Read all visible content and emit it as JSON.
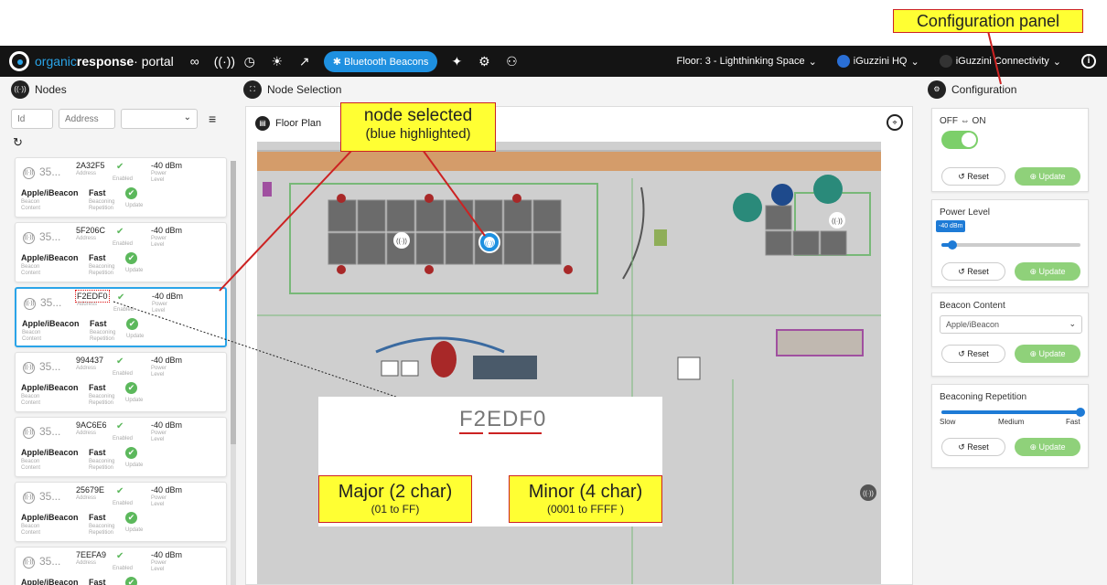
{
  "navbar": {
    "brand_part1": "organic",
    "brand_part2": "response",
    "brand_part3": "· portal",
    "nav_icons": [
      "glasses-icon",
      "broadcast-icon",
      "clock-icon",
      "lightbulb-icon",
      "rocket-icon"
    ],
    "active_tab": "Bluetooth Beacons",
    "extra_icons": [
      "puzzle-icon",
      "gear-icon",
      "users-icon"
    ],
    "floor_dropdown": "Floor: 3 - Lighthinking Space",
    "hq_dropdown": "iGuzzini HQ",
    "connectivity_dropdown": "iGuzzini Connectivity"
  },
  "nodes_panel": {
    "title": "Nodes",
    "id_placeholder": "Id",
    "address_placeholder": "Address",
    "items": [
      {
        "num": "35...",
        "address": "2A32F5",
        "address_label": "Address",
        "enabled_label": "Enabled",
        "power": "-40 dBm",
        "power_label": "Power Level",
        "content": "Apple/iBeacon",
        "content_label": "Beacon Content",
        "repetition": "Fast",
        "repetition_label": "Beaconing Repetition",
        "update_label": "Update"
      },
      {
        "num": "35...",
        "address": "5F206C",
        "address_label": "Address",
        "enabled_label": "Enabled",
        "power": "-40 dBm",
        "power_label": "Power Level",
        "content": "Apple/iBeacon",
        "content_label": "Beacon Content",
        "repetition": "Fast",
        "repetition_label": "Beaconing Repetition",
        "update_label": "Update"
      },
      {
        "num": "35...",
        "address": "F2EDF0",
        "address_label": "Address",
        "enabled_label": "Enabled",
        "power": "-40 dBm",
        "power_label": "Power Level",
        "content": "Apple/iBeacon",
        "content_label": "Beacon Content",
        "repetition": "Fast",
        "repetition_label": "Beaconing Repetition",
        "update_label": "Update"
      },
      {
        "num": "35...",
        "address": "994437",
        "address_label": "Address",
        "enabled_label": "Enabled",
        "power": "-40 dBm",
        "power_label": "Power Level",
        "content": "Apple/iBeacon",
        "content_label": "Beacon Content",
        "repetition": "Fast",
        "repetition_label": "Beaconing Repetition",
        "update_label": "Update"
      },
      {
        "num": "35...",
        "address": "9AC6E6",
        "address_label": "Address",
        "enabled_label": "Enabled",
        "power": "-40 dBm",
        "power_label": "Power Level",
        "content": "Apple/iBeacon",
        "content_label": "Beacon Content",
        "repetition": "Fast",
        "repetition_label": "Beaconing Repetition",
        "update_label": "Update"
      },
      {
        "num": "35...",
        "address": "25679E",
        "address_label": "Address",
        "enabled_label": "Enabled",
        "power": "-40 dBm",
        "power_label": "Power Level",
        "content": "Apple/iBeacon",
        "content_label": "Beacon Content",
        "repetition": "Fast",
        "repetition_label": "Beaconing Repetition",
        "update_label": "Update"
      },
      {
        "num": "35...",
        "address": "7EEFA9",
        "address_label": "Address",
        "enabled_label": "Enabled",
        "power": "-40 dBm",
        "power_label": "Power Level",
        "content": "Apple/iBeacon",
        "content_label": "Beacon Content",
        "repetition": "Fast",
        "repetition_label": "Beaconing Repetition",
        "update_label": "Update"
      }
    ],
    "selected_index": 2
  },
  "center_panel": {
    "title": "Node Selection",
    "floor_plan_title": "Floor Plan"
  },
  "config_panel": {
    "title": "Configuration",
    "onoff": {
      "title": "OFF ⇔ ON",
      "on": true
    },
    "power": {
      "title": "Power Level",
      "value": "-40 dBm",
      "level_fraction": 0.08
    },
    "content": {
      "title": "Beacon Content",
      "selected": "Apple/iBeacon"
    },
    "repetition": {
      "title": "Beaconing Repetition",
      "labels": [
        "Slow",
        "Medium",
        "Fast"
      ],
      "level_fraction": 1.0
    },
    "reset_label": "Reset",
    "update_label": "Update"
  },
  "annotations": {
    "config_panel": "Configuration panel",
    "node_selected_line1": "node selected",
    "node_selected_line2": "(blue highlighted)",
    "big_address_major": "F2",
    "big_address_minor": "EDF0",
    "major_line1": "Major (2 char)",
    "major_line2": "(01 to FF)",
    "minor_line1": "Minor (4 char)",
    "minor_line2": "(0001 to FFFF )"
  },
  "colors": {
    "accent": "#1e90e0",
    "selected_border": "#2aa4e8",
    "success": "#5cb85c",
    "update_button": "#8fd17a",
    "annotation_bg": "#ffff33",
    "annotation_line": "#cc2222"
  }
}
